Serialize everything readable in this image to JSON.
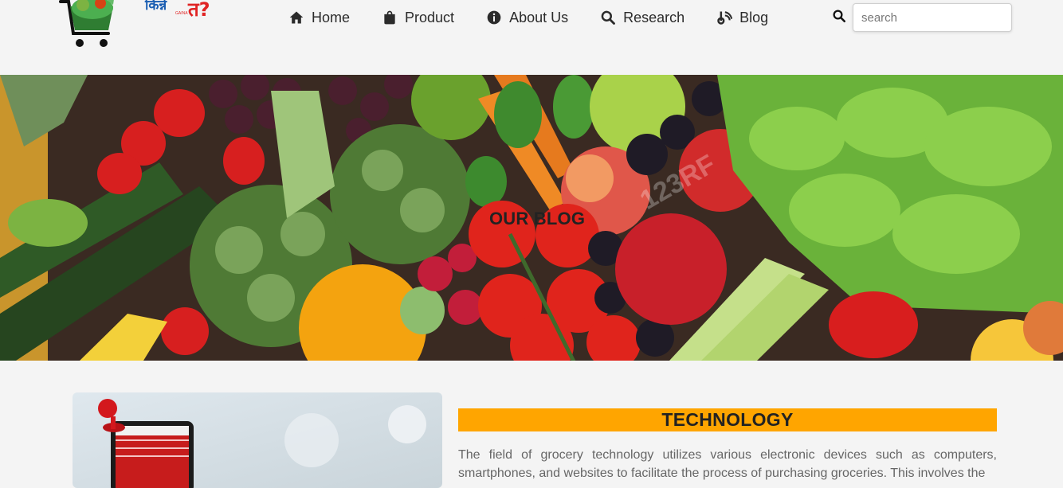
{
  "header": {
    "logo_text": "किन्ने",
    "logo_small": "GAINA",
    "logo_accent": "त?",
    "nav": [
      {
        "label": "Home",
        "icon": "home-icon"
      },
      {
        "label": "Product",
        "icon": "bag-icon"
      },
      {
        "label": "About Us",
        "icon": "info-icon"
      },
      {
        "label": "Research",
        "icon": "search-icon"
      },
      {
        "label": "Blog",
        "icon": "blog-icon"
      }
    ],
    "search": {
      "placeholder": "search",
      "value": ""
    }
  },
  "hero": {
    "title": "OUR BLOG",
    "watermark": "123RF"
  },
  "post": {
    "heading": "TECHNOLOGY",
    "text": "The field of grocery technology utilizes various electronic devices such as computers, smartphones, and websites to facilitate the process of purchasing groceries. This involves the"
  },
  "colors": {
    "accent": "#ffa500",
    "background": "#f4f4f4",
    "text": "#2b2b2b",
    "logo_blue": "#1b5fb3",
    "logo_red": "#e02424"
  }
}
